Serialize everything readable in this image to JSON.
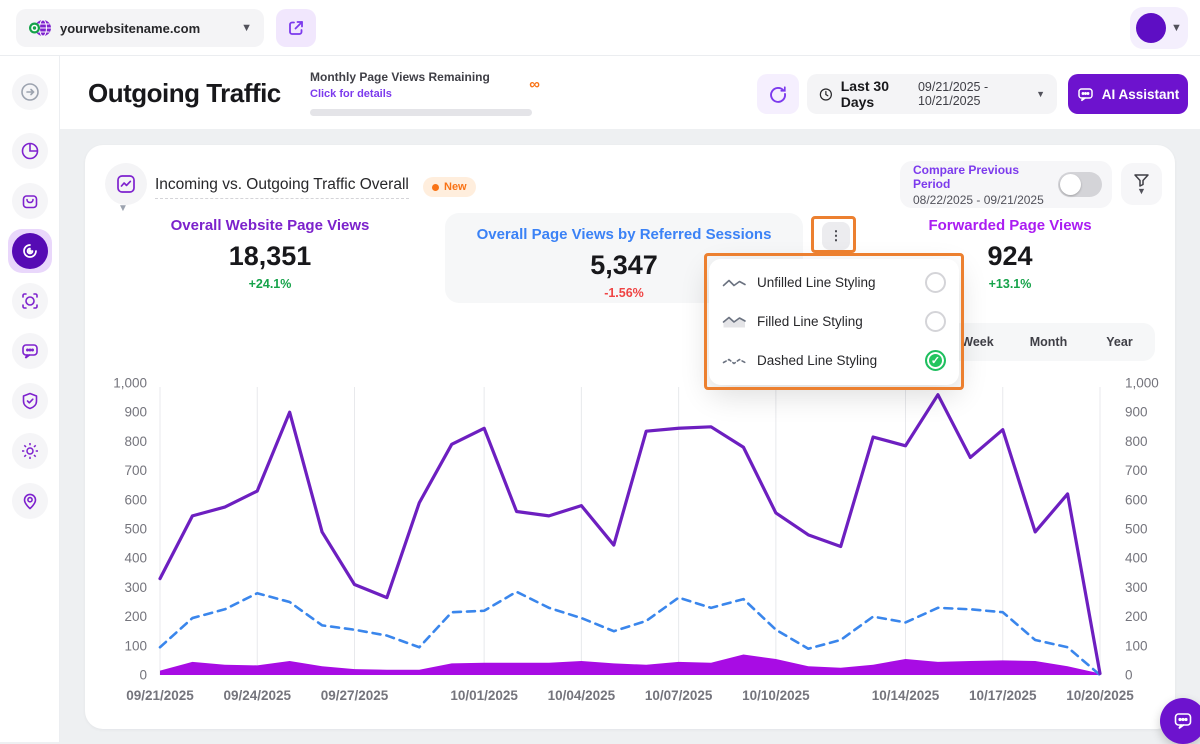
{
  "topbar": {
    "site": "yourwebsitename.com"
  },
  "header": {
    "title": "Outgoing Traffic",
    "quota": {
      "label": "Monthly Page Views Remaining",
      "link": "Click for details",
      "infinity": "∞"
    },
    "range": {
      "label": "Last 30 Days",
      "dates": "09/21/2025 - 10/21/2025"
    },
    "ai_label": "AI Assistant"
  },
  "sidebar": {
    "icons": [
      "arrow-right-circle",
      "pie-chart",
      "shopping-bag",
      "radar-active",
      "focus-scan",
      "chat-bubble",
      "shield-check",
      "gear",
      "location-pin"
    ]
  },
  "card": {
    "title": "Incoming vs. Outgoing Traffic Overall",
    "badge": "New",
    "compare": {
      "label": "Compare Previous Period",
      "dates": "08/22/2025 - 09/21/2025",
      "enabled": false
    },
    "stats": [
      {
        "label": "Overall Website Page Views",
        "value": "18,351",
        "delta": "+24.1%",
        "trend": "up"
      },
      {
        "label": "Overall Page Views by Referred Sessions",
        "value": "5,347",
        "delta": "-1.56%",
        "trend": "down"
      },
      {
        "label": "Forwarded Page Views",
        "value": "924",
        "delta": "+13.1%",
        "trend": "up"
      }
    ],
    "tabs": [
      "Week",
      "Month",
      "Year"
    ]
  },
  "menu": {
    "items": [
      {
        "label": "Unfilled Line Styling",
        "selected": false
      },
      {
        "label": "Filled Line Styling",
        "selected": false
      },
      {
        "label": "Dashed Line Styling",
        "selected": true
      }
    ]
  },
  "colors": {
    "accent_purple": "#6d13ce",
    "annotation_orange": "#ec8030",
    "selected_green": "#22c55e",
    "positive": "#16a34a",
    "negative": "#ef4444"
  },
  "chart_data": {
    "type": "line",
    "x": [
      "09/21/2025",
      "09/22/2025",
      "09/23/2025",
      "09/24/2025",
      "09/25/2025",
      "09/26/2025",
      "09/27/2025",
      "09/28/2025",
      "09/29/2025",
      "09/30/2025",
      "10/01/2025",
      "10/02/2025",
      "10/03/2025",
      "10/04/2025",
      "10/05/2025",
      "10/06/2025",
      "10/07/2025",
      "10/08/2025",
      "10/09/2025",
      "10/10/2025",
      "10/11/2025",
      "10/12/2025",
      "10/13/2025",
      "10/14/2025",
      "10/15/2025",
      "10/16/2025",
      "10/17/2025",
      "10/18/2025",
      "10/19/2025",
      "10/20/2025"
    ],
    "tick_labels": [
      "09/21/2025",
      "09/24/2025",
      "09/27/2025",
      "10/01/2025",
      "10/04/2025",
      "10/07/2025",
      "10/10/2025",
      "10/14/2025",
      "10/17/2025",
      "10/20/2025"
    ],
    "tick_indices": [
      0,
      3,
      6,
      10,
      13,
      16,
      19,
      23,
      26,
      29
    ],
    "ytick_labels": [
      "0",
      "100",
      "200",
      "300",
      "400",
      "500",
      "600",
      "700",
      "800",
      "900",
      "1,000"
    ],
    "ylim": [
      0,
      1000
    ],
    "grid": "vertical-only",
    "legend": "none",
    "series": [
      {
        "name": "Forwarded Page Views",
        "style": "area",
        "color": "#a80ce4",
        "values": [
          15,
          45,
          35,
          33,
          48,
          30,
          20,
          18,
          18,
          40,
          42,
          42,
          42,
          48,
          40,
          35,
          45,
          42,
          70,
          55,
          30,
          25,
          35,
          55,
          45,
          48,
          50,
          48,
          30,
          5
        ]
      },
      {
        "name": "Overall Page Views by Referred Sessions",
        "style": "dashed",
        "color": "#3a86ec",
        "values": [
          95,
          195,
          225,
          280,
          250,
          170,
          155,
          135,
          95,
          215,
          220,
          285,
          230,
          195,
          150,
          185,
          265,
          230,
          260,
          155,
          90,
          120,
          200,
          180,
          230,
          225,
          215,
          120,
          95,
          0
        ]
      },
      {
        "name": "Overall Website Page Views",
        "style": "solid",
        "color": "#6d1fc0",
        "values": [
          330,
          545,
          575,
          630,
          900,
          490,
          310,
          265,
          590,
          790,
          845,
          560,
          545,
          580,
          445,
          835,
          845,
          850,
          780,
          555,
          480,
          440,
          815,
          785,
          960,
          745,
          840,
          490,
          620,
          5
        ]
      }
    ]
  }
}
